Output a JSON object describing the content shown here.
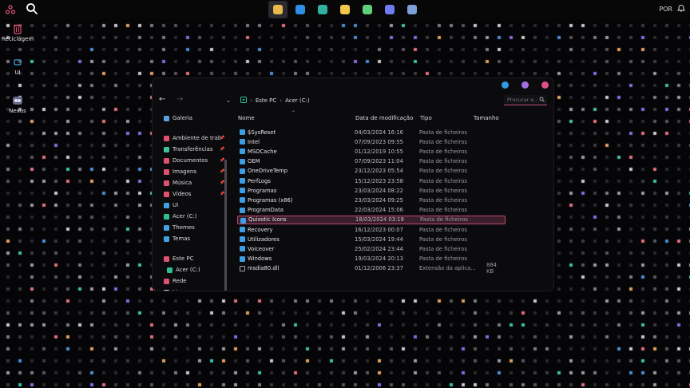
{
  "taskbar": {
    "apps": [
      {
        "name": "file-explorer-app-icon",
        "active": true,
        "color": "#e8b84a"
      },
      {
        "name": "vscode-app-icon",
        "active": false,
        "color": "#2e8ee6"
      },
      {
        "name": "edge-app-icon",
        "active": false,
        "color": "#2fb3a0"
      },
      {
        "name": "store-app-icon",
        "active": false,
        "color": "#f2c84a"
      },
      {
        "name": "browser-app-icon",
        "active": false,
        "color": "#5fd07a"
      },
      {
        "name": "discord-app-icon",
        "active": false,
        "color": "#6f7cf2"
      },
      {
        "name": "settings-app-icon",
        "active": false,
        "color": "#7ea0d8"
      }
    ],
    "language": "POR"
  },
  "desktop": {
    "icons": [
      {
        "label": "Reciclagem",
        "icon": "recycle-bin-icon"
      },
      {
        "label": "UI",
        "icon": "folder-icon"
      },
      {
        "label": "Nexus",
        "icon": "nexus-icon"
      }
    ]
  },
  "explorer": {
    "window_controls": [
      {
        "name": "minimize-button",
        "color": "#2f9be0"
      },
      {
        "name": "maximize-button",
        "color": "#a070e0"
      },
      {
        "name": "close-button",
        "color": "#e0508a"
      }
    ],
    "breadcrumb": [
      "Este PC",
      "Acer (C:)"
    ],
    "search_placeholder": "Procurar e...",
    "sidebar": [
      {
        "label": "Galeria",
        "icon": "gallery-icon",
        "color": "#5aa0e0",
        "pinned": false
      },
      {
        "label": "Ambiente de trab",
        "icon": "desktop-icon",
        "color": "#e05070",
        "pinned": true
      },
      {
        "label": "Transferências",
        "icon": "downloads-icon",
        "color": "#40c0a0",
        "pinned": true
      },
      {
        "label": "Documentos",
        "icon": "documents-icon",
        "color": "#e05070",
        "pinned": true
      },
      {
        "label": "Imagens",
        "icon": "images-icon",
        "color": "#e05070",
        "pinned": true
      },
      {
        "label": "Música",
        "icon": "music-icon",
        "color": "#e05070",
        "pinned": true
      },
      {
        "label": "Vídeos",
        "icon": "videos-icon",
        "color": "#e05070",
        "pinned": true
      },
      {
        "label": "UI",
        "icon": "folder-icon",
        "color": "#40a0e0",
        "pinned": false
      },
      {
        "label": "Acer (C:)",
        "icon": "drive-icon",
        "color": "#30c090",
        "pinned": false
      },
      {
        "label": "Themes",
        "icon": "folder-icon",
        "color": "#40a0e0",
        "pinned": false
      },
      {
        "label": "Temas",
        "icon": "folder-icon",
        "color": "#40a0e0",
        "pinned": false
      },
      {
        "label": "Este PC",
        "icon": "pc-icon",
        "color": "#e05070",
        "pinned": false
      },
      {
        "label": "Acer (C:)",
        "icon": "drive-icon",
        "color": "#30c090",
        "pinned": false
      },
      {
        "label": "Rede",
        "icon": "network-icon",
        "color": "#e05070",
        "pinned": false
      },
      {
        "label": "Linux",
        "icon": "linux-icon",
        "color": "#dddddd",
        "pinned": false
      }
    ],
    "columns": {
      "name": "Nome",
      "date": "Data de modificação",
      "type": "Tipo",
      "size": "Tamanho"
    },
    "files": [
      {
        "name": "$SysReset",
        "date": "04/03/2024 16:16",
        "type": "Pasta de ficheiros",
        "size": "",
        "kind": "folder"
      },
      {
        "name": "Intel",
        "date": "07/09/2023 09:55",
        "type": "Pasta de ficheiros",
        "size": "",
        "kind": "folder"
      },
      {
        "name": "MSOCache",
        "date": "01/12/2019 10:55",
        "type": "Pasta de ficheiros",
        "size": "",
        "kind": "folder"
      },
      {
        "name": "OEM",
        "date": "07/09/2023 11:04",
        "type": "Pasta de ficheiros",
        "size": "",
        "kind": "folder"
      },
      {
        "name": "OneDriveTemp",
        "date": "23/12/2023 05:54",
        "type": "Pasta de ficheiros",
        "size": "",
        "kind": "folder"
      },
      {
        "name": "PerfLogs",
        "date": "15/12/2023 23:58",
        "type": "Pasta de ficheiros",
        "size": "",
        "kind": "folder"
      },
      {
        "name": "Programas",
        "date": "23/03/2024 08:22",
        "type": "Pasta de ficheiros",
        "size": "",
        "kind": "folder"
      },
      {
        "name": "Programas (x86)",
        "date": "23/03/2024 09:25",
        "type": "Pasta de ficheiros",
        "size": "",
        "kind": "folder"
      },
      {
        "name": "ProgramData",
        "date": "22/03/2024 15:06",
        "type": "Pasta de ficheiros",
        "size": "",
        "kind": "folder"
      },
      {
        "name": "Quixotic Icons",
        "date": "18/03/2024 03:18",
        "type": "Pasta de ficheiros",
        "size": "",
        "kind": "folder",
        "selected": true
      },
      {
        "name": "Recovery",
        "date": "16/12/2023 00:07",
        "type": "Pasta de ficheiros",
        "size": "",
        "kind": "folder"
      },
      {
        "name": "Utilizadores",
        "date": "15/03/2024 19:44",
        "type": "Pasta de ficheiros",
        "size": "",
        "kind": "folder"
      },
      {
        "name": "Voiceover",
        "date": "25/02/2024 23:44",
        "type": "Pasta de ficheiros",
        "size": "",
        "kind": "folder"
      },
      {
        "name": "Windows",
        "date": "19/03/2024 20:13",
        "type": "Pasta de ficheiros",
        "size": "",
        "kind": "folder"
      },
      {
        "name": "msdia80.dll",
        "date": "01/12/2006 23:37",
        "type": "Extensão da aplica...",
        "size": "884 KB",
        "kind": "dll"
      }
    ]
  }
}
